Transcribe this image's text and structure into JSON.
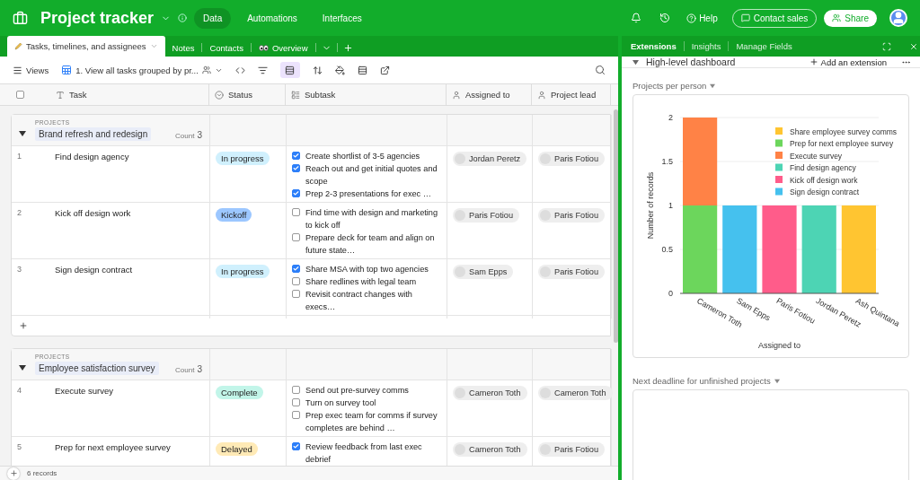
{
  "app": {
    "title": "Project tracker",
    "nav": [
      {
        "label": "Data",
        "selected": true
      },
      {
        "label": "Automations",
        "selected": false
      },
      {
        "label": "Interfaces",
        "selected": false
      }
    ],
    "help": "Help",
    "contact": "Contact sales",
    "share": "Share"
  },
  "tables": [
    {
      "label": "Tasks, timelines, and assignees",
      "selected": true,
      "kind": "pencil"
    },
    {
      "label": "Notes",
      "selected": false
    },
    {
      "label": "Contacts",
      "selected": false
    },
    {
      "label": "Overview",
      "selected": false,
      "kind": "eyes"
    }
  ],
  "toolbar": {
    "views": "Views",
    "view_name": "1. View all tasks grouped by pr...",
    "grouped": true
  },
  "select_all": {
    "checked": false
  },
  "columns": [
    {
      "label": "Task",
      "kind": "text"
    },
    {
      "label": "Status",
      "kind": "select"
    },
    {
      "label": "Subtask",
      "kind": "longtext"
    },
    {
      "label": "Assigned to",
      "kind": "user"
    },
    {
      "label": "Project lead",
      "kind": "user"
    }
  ],
  "groups": [
    {
      "field": "PROJECTS",
      "name": "Brand refresh and redesign",
      "count_label": "Count",
      "count": "3",
      "expanded": true,
      "rows": [
        {
          "number": "1",
          "task": "Find design agency",
          "status": "In progress",
          "color": "#d0f0fd",
          "subtasks": [
            {
              "text": "Create shortlist of 3-5 agencies",
              "checked": true
            },
            {
              "text": "Reach out and get initial quotes and scope",
              "checked": true
            },
            {
              "text": "Prep 2-3 presentations for exec …",
              "checked": true
            }
          ],
          "assigned": "Jordan Peretz",
          "lead": "Paris Fotiou"
        },
        {
          "number": "2",
          "task": "Kick off design work",
          "status": "Kickoff",
          "color": "#9cc7ff",
          "subtasks": [
            {
              "text": "Find time with design and marketing to kick off",
              "checked": false
            },
            {
              "text": "Prepare deck for team and align on future state…",
              "checked": false
            }
          ],
          "assigned": "Paris Fotiou",
          "lead": "Paris Fotiou"
        },
        {
          "number": "3",
          "task": "Sign design contract",
          "status": "In progress",
          "color": "#d0f0fd",
          "subtasks": [
            {
              "text": "Share MSA with top two agencies",
              "checked": true
            },
            {
              "text": "Share redlines with legal team",
              "checked": false
            },
            {
              "text": "Revisit contract changes with execs…",
              "checked": false
            }
          ],
          "assigned": "Sam Epps",
          "lead": "Paris Fotiou"
        }
      ]
    },
    {
      "field": "PROJECTS",
      "name": "Employee satisfaction survey",
      "count_label": "Count",
      "count": "3",
      "expanded": true,
      "rows": [
        {
          "number": "4",
          "task": "Execute survey",
          "status": "Complete",
          "color": "#c2f5e9",
          "subtasks": [
            {
              "text": "Send out pre-survey comms",
              "checked": false
            },
            {
              "text": "Turn on survey tool",
              "checked": false
            },
            {
              "text": "Prep exec team for comms if survey completes are behind …",
              "checked": false
            }
          ],
          "assigned": "Cameron Toth",
          "lead": "Cameron Toth"
        },
        {
          "number": "5",
          "task": "Prep for next employee survey",
          "status": "Delayed",
          "color": "#ffeab6",
          "subtasks": [
            {
              "text": "Review feedback from last exec debrief",
              "checked": true
            }
          ],
          "assigned": "Cameron Toth",
          "lead": "Paris Fotiou"
        }
      ]
    }
  ],
  "footer": {
    "records": "6 records"
  },
  "panel": {
    "tabs": [
      {
        "label": "Extensions",
        "selected": true
      },
      {
        "label": "Insights",
        "selected": false
      },
      {
        "label": "Manage Fields",
        "selected": false
      }
    ],
    "dashboard": "High-level dashboard",
    "expanded": true,
    "add": "Add an extension",
    "widgets": [
      {
        "title": "Projects per person",
        "chart_data": {
          "type": "bar",
          "stacked": true,
          "grid": true,
          "legend": true,
          "xlabel": "Assigned to",
          "ylabel": "Number of records",
          "categories": [
            "Cameron Toth",
            "Sam Epps",
            "Paris Fotiou",
            "Jordan Peretz",
            "Ash Quintana"
          ],
          "ylim": [
            0,
            2
          ],
          "yticks": [
            0,
            0.5,
            1,
            1.5,
            2
          ],
          "series": [
            {
              "name": "Share employee survey comms",
              "color": "#ffc531",
              "values": [
                null,
                null,
                null,
                null,
                1
              ]
            },
            {
              "name": "Prep for next employee survey",
              "color": "#6cd65c",
              "values": [
                1,
                null,
                null,
                null,
                null
              ]
            },
            {
              "name": "Execute survey",
              "color": "#ff8246",
              "values": [
                1,
                null,
                null,
                null,
                null
              ]
            },
            {
              "name": "Find design agency",
              "color": "#4dd4b4",
              "values": [
                null,
                null,
                null,
                1,
                null
              ]
            },
            {
              "name": "Kick off design work",
              "color": "#ff5c8a",
              "values": [
                null,
                null,
                1,
                null,
                null
              ]
            },
            {
              "name": "Sign design contract",
              "color": "#45c1ee",
              "values": [
                null,
                1,
                null,
                null,
                null
              ]
            }
          ]
        }
      },
      {
        "title": "Next deadline for unfinished projects"
      }
    ]
  }
}
